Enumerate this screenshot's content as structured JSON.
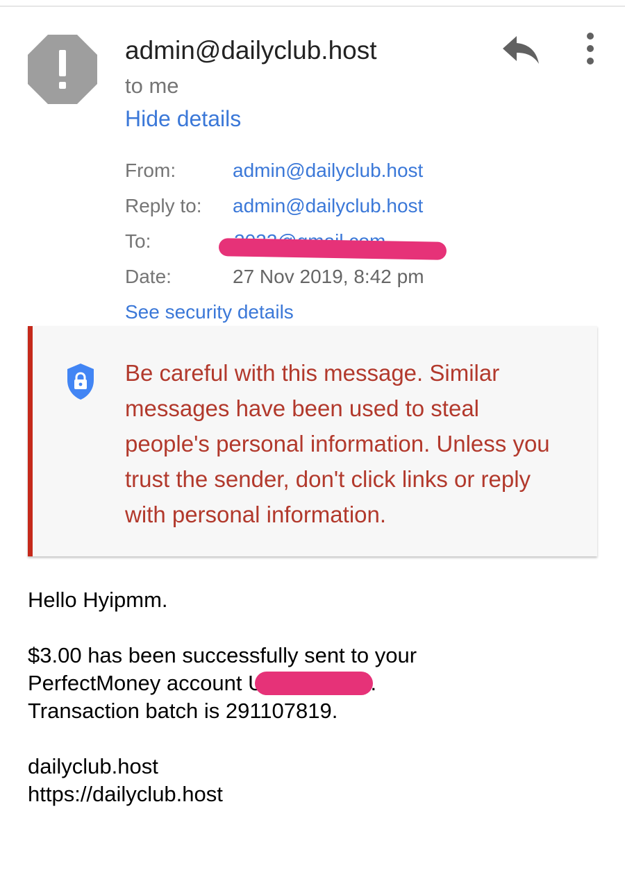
{
  "header": {
    "sender": "admin@dailyclub.host",
    "recipient_summary": "to me",
    "hide_details_label": "Hide details"
  },
  "avatar": {
    "icon": "spam-warning-icon",
    "color": "#9e9e9e",
    "glyph": "!"
  },
  "actions": {
    "reply_icon": "reply-icon",
    "more_icon": "more-vert-icon"
  },
  "details": {
    "from_label": "From:",
    "from_value": "admin@dailyclub.host",
    "reply_to_label": "Reply to:",
    "reply_to_value": "admin@dailyclub.host",
    "to_label": "To:",
    "to_value_visible": "2022@gmail.com",
    "date_label": "Date:",
    "date_value": "27 Nov 2019, 8:42 pm",
    "security_link": "See security details"
  },
  "warning": {
    "icon": "security-shield-lock-icon",
    "text": "Be careful with this message. Similar messages have been used to steal people's personal information. Unless you trust the sender, don't click links or reply with personal information.",
    "accent_color": "#c5291b",
    "text_color": "#b2392c"
  },
  "body": {
    "greeting": "Hello Hyipmm.",
    "line1": "$3.00 has been successfully sent to your",
    "line2_prefix": "PerfectMoney account ",
    "line2_visible_char": "U",
    "line2_suffix": ".",
    "line3": "Transaction batch is 291107819.",
    "signature_name": "dailyclub.host",
    "signature_url": "https://dailyclub.host"
  },
  "redaction_color": "#e63278"
}
